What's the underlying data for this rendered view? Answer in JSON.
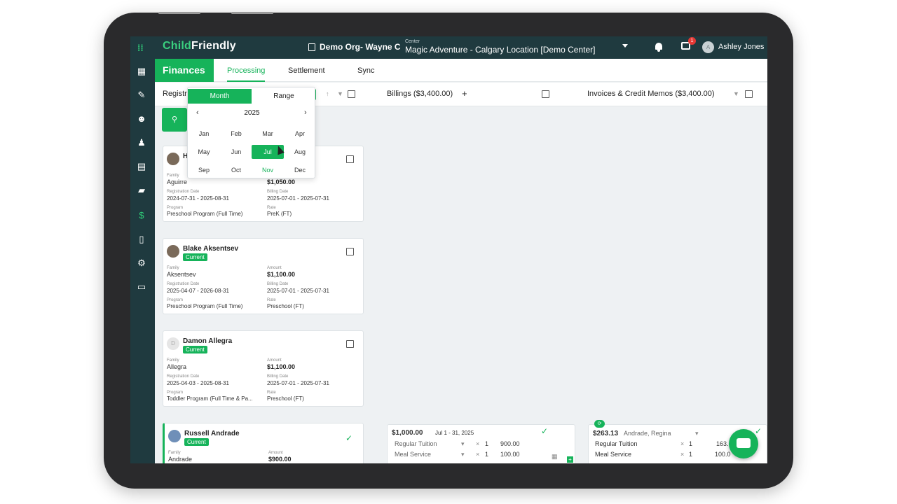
{
  "brand": {
    "part1": "Child",
    "part2": "Friendly"
  },
  "topbar": {
    "org": "Demo Org- Wayne C",
    "center_label": "Center",
    "center_value": "Magic Adventure - Calgary Location [Demo Center]",
    "badge_count": "1",
    "user_initial": "A",
    "user_name": "Ashley Jones"
  },
  "finances": {
    "title": "Finances",
    "tabs": [
      "Processing",
      "Settlement",
      "Sync"
    ]
  },
  "columns": {
    "registrations_label": "Registrati",
    "billings_label": "Billings ($3,400.00)",
    "invoices_label": "Invoices & Credit Memos ($3,400.00)"
  },
  "picker": {
    "mode_month": "Month",
    "mode_range": "Range",
    "year": "2025",
    "months": [
      "Jan",
      "Feb",
      "Mar",
      "Apr",
      "May",
      "Jun",
      "Jul",
      "Aug",
      "Sep",
      "Oct",
      "Nov",
      "Dec"
    ],
    "selected": "Jul",
    "current": "Nov"
  },
  "field_labels": {
    "family": "Family",
    "amount": "Amount",
    "registration_date": "Registration Date",
    "billing_date": "Billing Date",
    "program": "Program",
    "rate": "Rate"
  },
  "cards": [
    {
      "name": "H",
      "status": "",
      "family": "Aguirre",
      "amount": "$1,050.00",
      "reg_date": "2024-07-31 - 2025-08-31",
      "bill_date": "2025-07-01 - 2025-07-31",
      "program": "Preschool Program (Full Time)",
      "rate": "PreK (FT)"
    },
    {
      "name": "Blake Aksentsev",
      "status": "Current",
      "family": "Aksentsev",
      "amount": "$1,100.00",
      "reg_date": "2025-04-07 - 2026-08-31",
      "bill_date": "2025-07-01 - 2025-07-31",
      "program": "Preschool Program (Full Time)",
      "rate": "Preschool (FT)"
    },
    {
      "name": "Damon Allegra",
      "status": "Current",
      "avatar": "D",
      "family": "Allegra",
      "amount": "$1,100.00",
      "reg_date": "2025-04-03 - 2025-08-31",
      "bill_date": "2025-07-01 - 2025-07-31",
      "program": "Toddler Program (Full Time & Pa...",
      "rate": "Preschool (FT)"
    },
    {
      "name": "Russell Andrade",
      "status": "Current",
      "family": "Andrade",
      "amount": "$900.00"
    }
  ],
  "billing_snippet": {
    "amount": "$1,000.00",
    "period": "Jul 1 - 31, 2025",
    "lines": [
      {
        "item": "Regular Tuition",
        "qty": "1",
        "price": "900.00"
      },
      {
        "item": "Meal Service",
        "qty": "1",
        "price": "100.00"
      }
    ]
  },
  "invoice_snippet": {
    "amount": "$263.13",
    "family": "Andrade, Regina",
    "lines": [
      {
        "item": "Regular Tuition",
        "qty": "1",
        "price": "163."
      },
      {
        "item": "Meal Service",
        "qty": "1",
        "price": "100.0"
      }
    ]
  }
}
